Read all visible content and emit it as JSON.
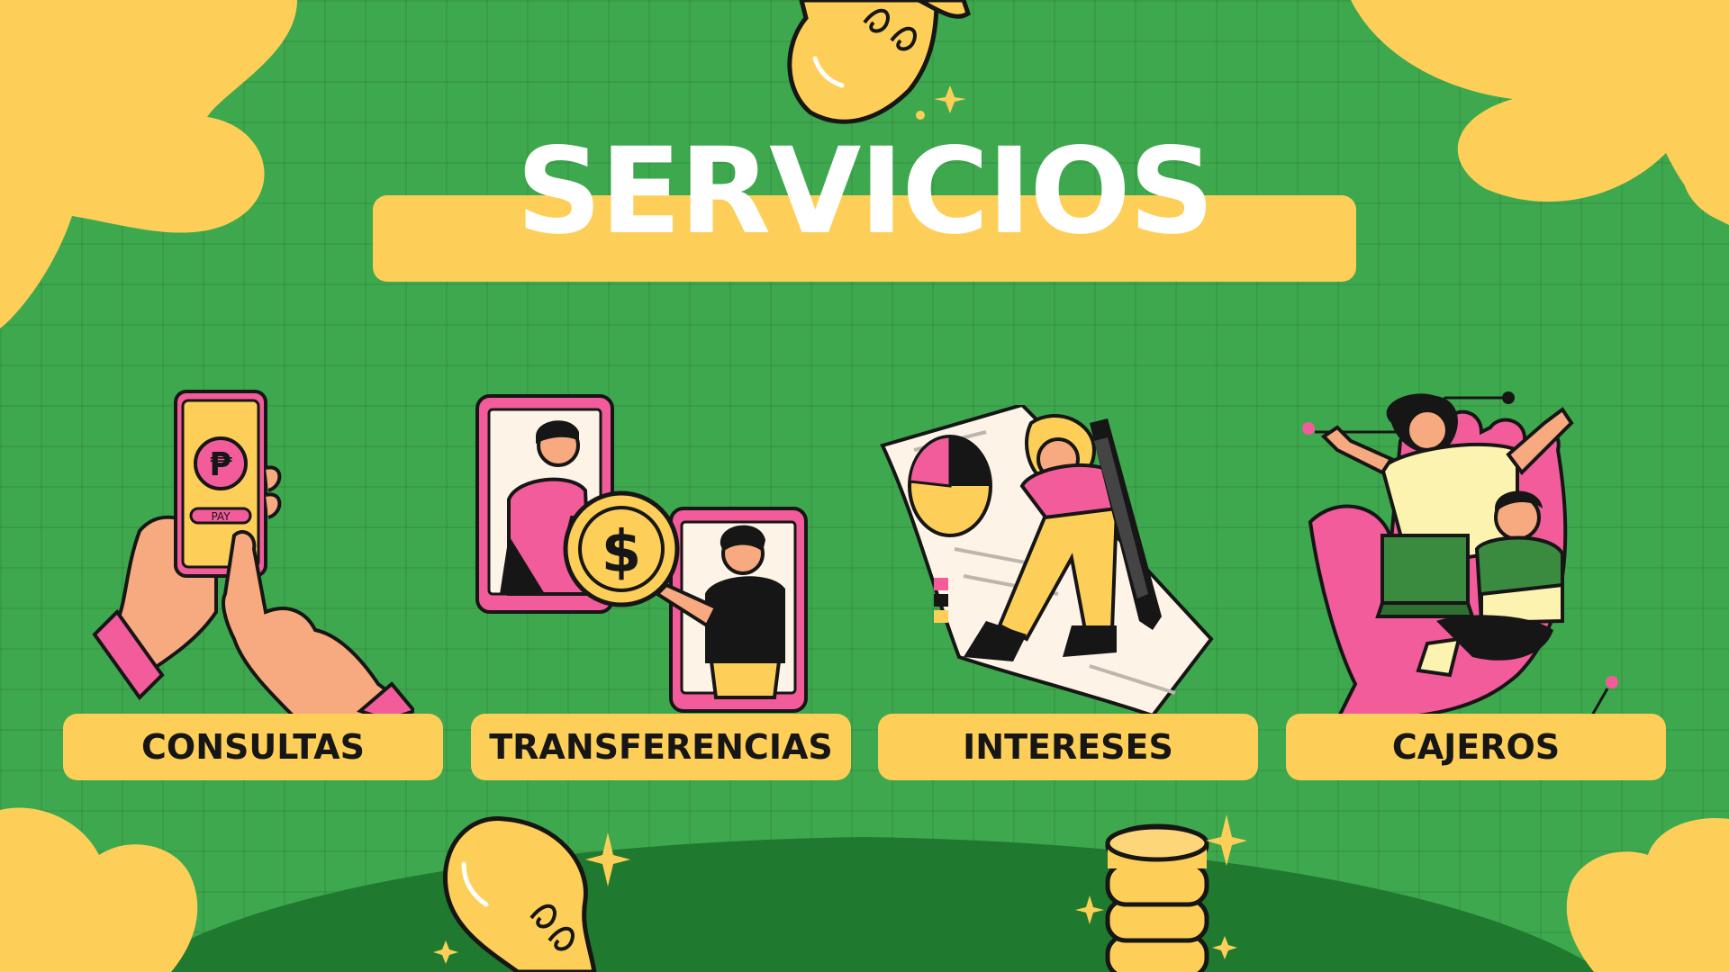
{
  "slide": {
    "title": "SERVICIOS",
    "colors": {
      "background": "#3ea84e",
      "dark_green": "#1f7a2f",
      "accent_yellow": "#fecf58",
      "pink": "#f25c9a",
      "title_text": "#ffffff",
      "label_text": "#161616"
    },
    "phone_pay_label": "PAY",
    "services": [
      {
        "label": "CONSULTAS",
        "icon": "phone-payment-icon"
      },
      {
        "label": "TRANSFERENCIAS",
        "icon": "money-transfer-icon"
      },
      {
        "label": "INTERESES",
        "icon": "document-chart-icon"
      },
      {
        "label": "CAJEROS",
        "icon": "hand-holding-people-icon"
      }
    ]
  }
}
